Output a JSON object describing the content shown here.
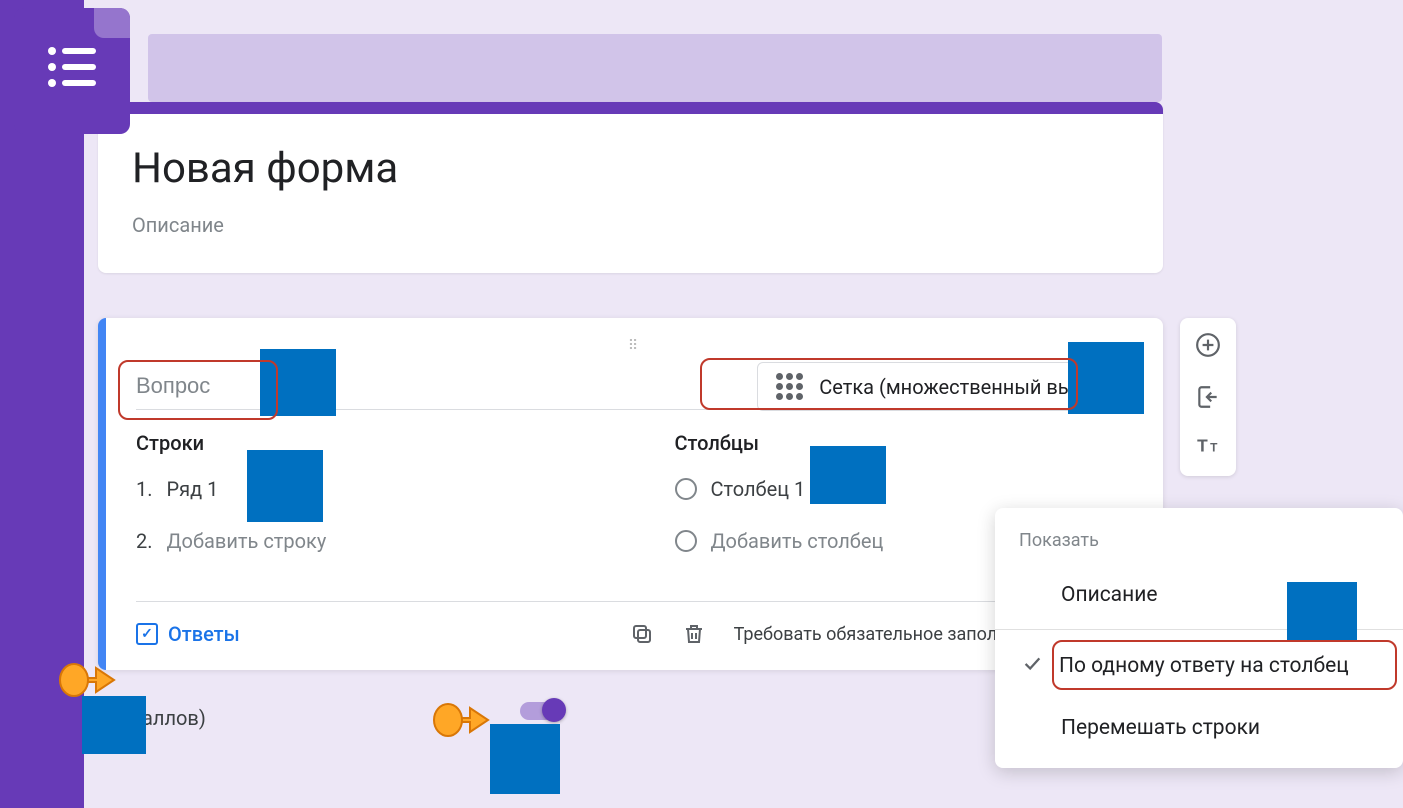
{
  "form": {
    "title": "Новая форма",
    "description": "Описание"
  },
  "question": {
    "placeholder": "Вопрос",
    "type_label": "Сетка (множественный выбор)",
    "rows_label": "Строки",
    "cols_label": "Столбцы",
    "row_items": [
      "Ряд 1"
    ],
    "add_row": "Добавить строку",
    "col_items": [
      "Столбец 1"
    ],
    "add_col": "Добавить столбец"
  },
  "footer": {
    "answers": "Ответы",
    "points_suffix": "аллов)",
    "require_label": "Требовать обязательное заполнение всех стро"
  },
  "popup": {
    "header": "Показать",
    "desc": "Описание",
    "limit": "По одному ответу на столбец",
    "shuffle": "Перемешать строки"
  }
}
